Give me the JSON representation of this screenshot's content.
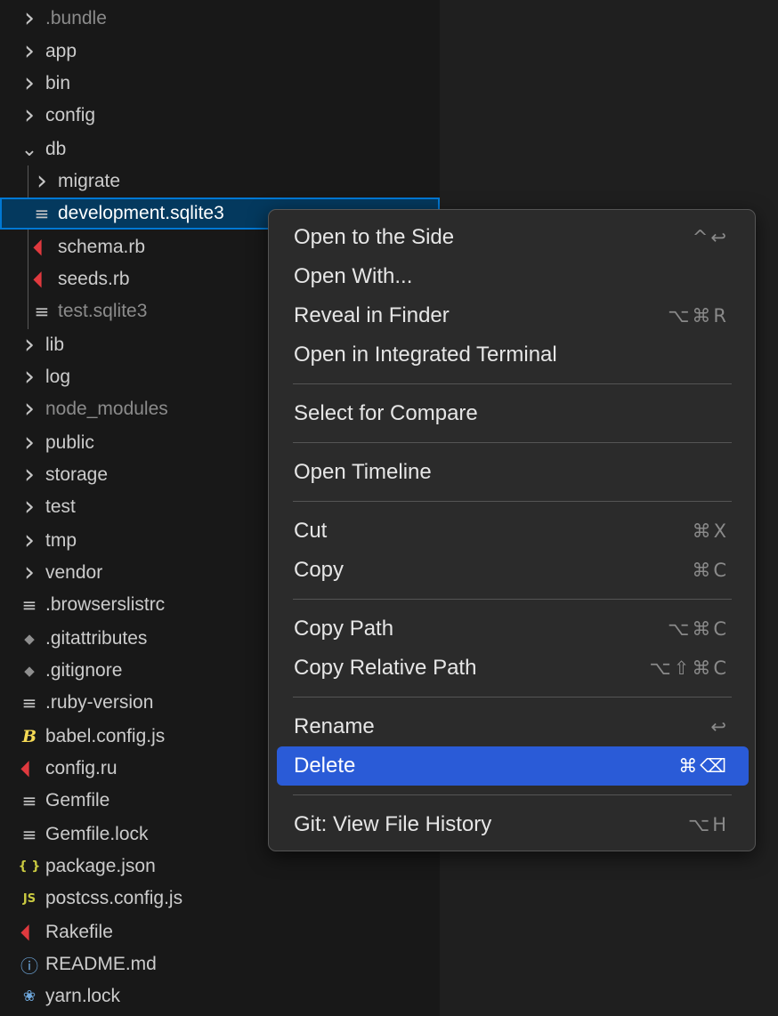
{
  "explorer": {
    "items": [
      {
        "name": ".bundle",
        "kind": "folder",
        "state": "collapsed",
        "depth": 0,
        "dim": true,
        "icon": "chevron-right"
      },
      {
        "name": "app",
        "kind": "folder",
        "state": "collapsed",
        "depth": 0,
        "icon": "chevron-right"
      },
      {
        "name": "bin",
        "kind": "folder",
        "state": "collapsed",
        "depth": 0,
        "icon": "chevron-right"
      },
      {
        "name": "config",
        "kind": "folder",
        "state": "collapsed",
        "depth": 0,
        "icon": "chevron-right"
      },
      {
        "name": "db",
        "kind": "folder",
        "state": "expanded",
        "depth": 0,
        "icon": "chevron-down"
      },
      {
        "name": "migrate",
        "kind": "folder",
        "state": "collapsed",
        "depth": 1,
        "icon": "chevron-right"
      },
      {
        "name": "development.sqlite3",
        "kind": "file",
        "depth": 1,
        "selected": true,
        "icon": "file-lines"
      },
      {
        "name": "schema.rb",
        "kind": "file",
        "depth": 1,
        "icon": "ruby"
      },
      {
        "name": "seeds.rb",
        "kind": "file",
        "depth": 1,
        "icon": "ruby"
      },
      {
        "name": "test.sqlite3",
        "kind": "file",
        "depth": 1,
        "dim": true,
        "icon": "file-lines"
      },
      {
        "name": "lib",
        "kind": "folder",
        "state": "collapsed",
        "depth": 0,
        "icon": "chevron-right"
      },
      {
        "name": "log",
        "kind": "folder",
        "state": "collapsed",
        "depth": 0,
        "icon": "chevron-right"
      },
      {
        "name": "node_modules",
        "kind": "folder",
        "state": "collapsed",
        "depth": 0,
        "dim": true,
        "icon": "chevron-right"
      },
      {
        "name": "public",
        "kind": "folder",
        "state": "collapsed",
        "depth": 0,
        "icon": "chevron-right"
      },
      {
        "name": "storage",
        "kind": "folder",
        "state": "collapsed",
        "depth": 0,
        "icon": "chevron-right"
      },
      {
        "name": "test",
        "kind": "folder",
        "state": "collapsed",
        "depth": 0,
        "icon": "chevron-right"
      },
      {
        "name": "tmp",
        "kind": "folder",
        "state": "collapsed",
        "depth": 0,
        "icon": "chevron-right"
      },
      {
        "name": "vendor",
        "kind": "folder",
        "state": "collapsed",
        "depth": 0,
        "icon": "chevron-right"
      },
      {
        "name": ".browserslistrc",
        "kind": "file",
        "depth": 0,
        "icon": "file-lines"
      },
      {
        "name": ".gitattributes",
        "kind": "file",
        "depth": 0,
        "icon": "git"
      },
      {
        "name": ".gitignore",
        "kind": "file",
        "depth": 0,
        "icon": "git"
      },
      {
        "name": ".ruby-version",
        "kind": "file",
        "depth": 0,
        "icon": "file-lines"
      },
      {
        "name": "babel.config.js",
        "kind": "file",
        "depth": 0,
        "icon": "babel"
      },
      {
        "name": "config.ru",
        "kind": "file",
        "depth": 0,
        "icon": "ruby"
      },
      {
        "name": "Gemfile",
        "kind": "file",
        "depth": 0,
        "icon": "file-lines"
      },
      {
        "name": "Gemfile.lock",
        "kind": "file",
        "depth": 0,
        "icon": "file-lines"
      },
      {
        "name": "package.json",
        "kind": "file",
        "depth": 0,
        "icon": "json"
      },
      {
        "name": "postcss.config.js",
        "kind": "file",
        "depth": 0,
        "icon": "javascript"
      },
      {
        "name": "Rakefile",
        "kind": "file",
        "depth": 0,
        "icon": "ruby"
      },
      {
        "name": "README.md",
        "kind": "file",
        "depth": 0,
        "icon": "info"
      },
      {
        "name": "yarn.lock",
        "kind": "file",
        "depth": 0,
        "icon": "yarn"
      }
    ]
  },
  "context_menu": {
    "groups": [
      [
        {
          "label": "Open to the Side",
          "shortcut": "^↩"
        },
        {
          "label": "Open With...",
          "shortcut": ""
        },
        {
          "label": "Reveal in Finder",
          "shortcut": "⌥⌘R"
        },
        {
          "label": "Open in Integrated Terminal",
          "shortcut": ""
        }
      ],
      [
        {
          "label": "Select for Compare",
          "shortcut": ""
        }
      ],
      [
        {
          "label": "Open Timeline",
          "shortcut": ""
        }
      ],
      [
        {
          "label": "Cut",
          "shortcut": "⌘X"
        },
        {
          "label": "Copy",
          "shortcut": "⌘C"
        }
      ],
      [
        {
          "label": "Copy Path",
          "shortcut": "⌥⌘C"
        },
        {
          "label": "Copy Relative Path",
          "shortcut": "⌥⇧⌘C"
        }
      ],
      [
        {
          "label": "Rename",
          "shortcut": "↩"
        },
        {
          "label": "Delete",
          "shortcut": "⌘⌫",
          "active": true
        }
      ],
      [
        {
          "label": "Git: View File History",
          "shortcut": "⌥H"
        }
      ]
    ]
  },
  "colors": {
    "selection_background": "#04395e",
    "selection_border": "#0078d4",
    "menu_highlight": "#2a5bd7",
    "ruby_icon": "#e0393e"
  }
}
